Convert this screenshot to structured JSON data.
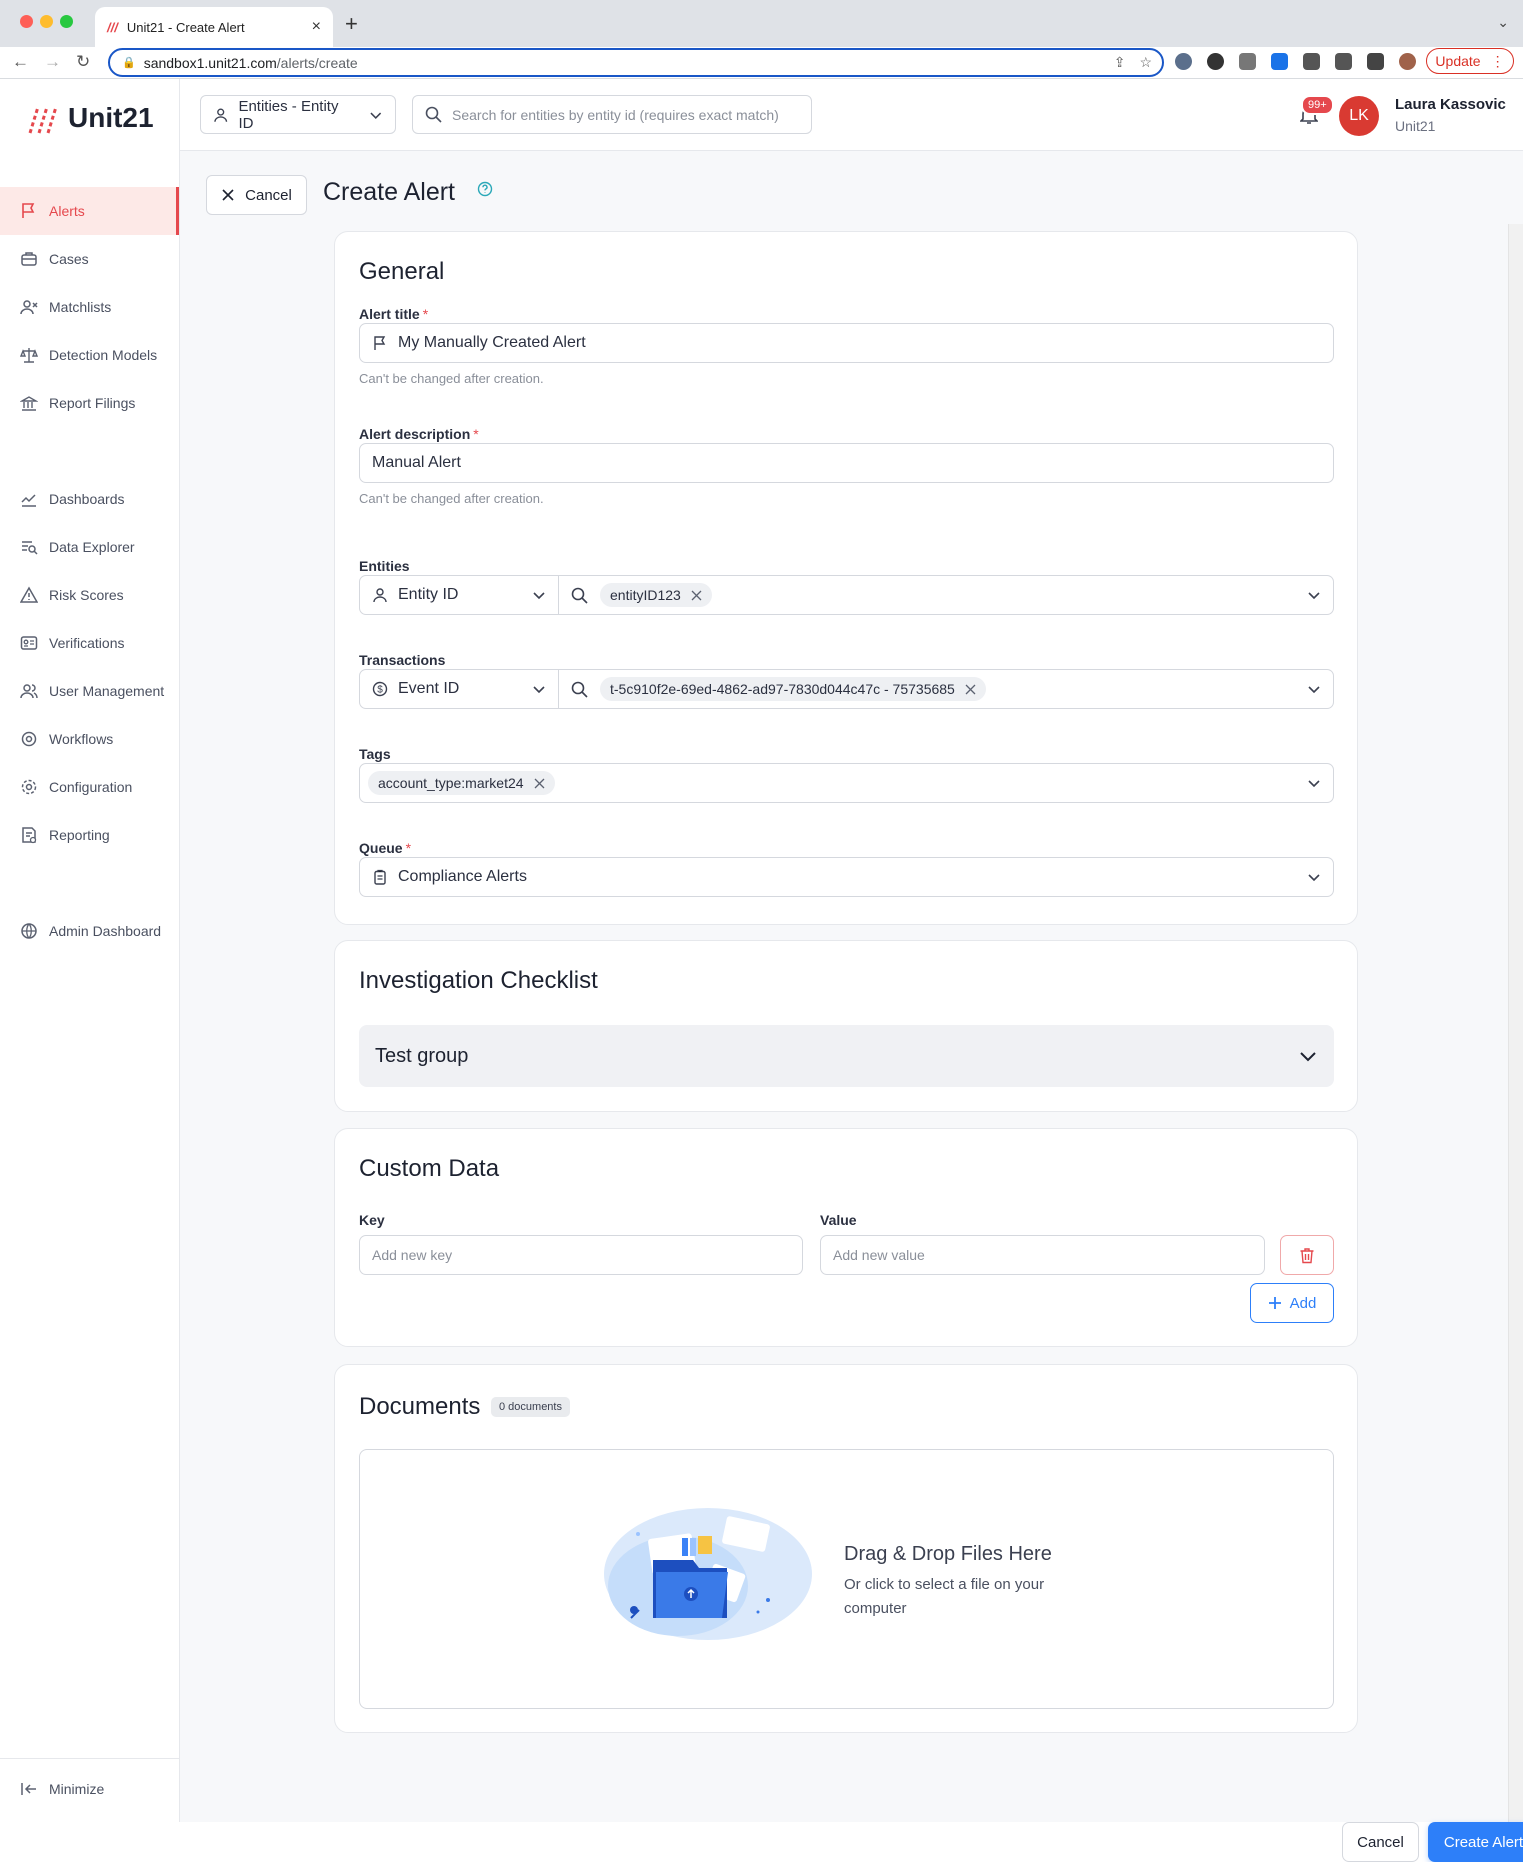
{
  "browser": {
    "tab_title": "Unit21 - Create Alert",
    "url_host": "sandbox1.unit21.com",
    "url_path": "/alerts/create",
    "update_label": "Update"
  },
  "app": {
    "logo_text": "Unit21",
    "brand_color": "#e5484d",
    "accent_color": "#2d7ff9"
  },
  "sidebar": {
    "items": [
      {
        "label": "Alerts",
        "icon": "flag-icon",
        "active": true
      },
      {
        "label": "Cases",
        "icon": "briefcase-icon"
      },
      {
        "label": "Matchlists",
        "icon": "user-x-icon"
      },
      {
        "label": "Detection Models",
        "icon": "scale-icon"
      },
      {
        "label": "Report Filings",
        "icon": "bank-icon"
      },
      {
        "label": "Dashboards",
        "icon": "line-chart-icon"
      },
      {
        "label": "Data Explorer",
        "icon": "data-search-icon"
      },
      {
        "label": "Risk Scores",
        "icon": "warning-icon"
      },
      {
        "label": "Verifications",
        "icon": "id-card-icon"
      },
      {
        "label": "User Management",
        "icon": "users-icon"
      },
      {
        "label": "Workflows",
        "icon": "workflow-icon"
      },
      {
        "label": "Configuration",
        "icon": "gear-icon"
      },
      {
        "label": "Reporting",
        "icon": "report-icon"
      },
      {
        "label": "Admin Dashboard",
        "icon": "globe-icon"
      }
    ],
    "minimize_label": "Minimize"
  },
  "topbar": {
    "entity_select": "Entities - Entity ID",
    "search_placeholder": "Search for entities by entity id (requires exact match)",
    "notifications_count": "99+",
    "user_initials": "LK",
    "user_name": "Laura Kassovic",
    "user_org": "Unit21"
  },
  "page": {
    "cancel_label": "Cancel",
    "title": "Create Alert"
  },
  "general": {
    "heading": "General",
    "alert_title_label": "Alert title",
    "alert_title_value": "My Manually Created Alert",
    "alert_title_hint": "Can't be changed after creation.",
    "alert_desc_label": "Alert description",
    "alert_desc_value": "Manual Alert",
    "alert_desc_hint": "Can't be changed after creation.",
    "entities_label": "Entities",
    "entities_type": "Entity ID",
    "entities_chip": "entityID123",
    "transactions_label": "Transactions",
    "transactions_type": "Event ID",
    "transactions_chip": "t-5c910f2e-69ed-4862-ad97-7830d044c47c - 75735685",
    "tags_label": "Tags",
    "tags_chip": "account_type:market24",
    "queue_label": "Queue",
    "queue_value": "Compliance Alerts"
  },
  "checklist": {
    "heading": "Investigation Checklist",
    "group_label": "Test group"
  },
  "custom_data": {
    "heading": "Custom Data",
    "key_label": "Key",
    "key_placeholder": "Add new key",
    "value_label": "Value",
    "value_placeholder": "Add new value",
    "add_label": "Add"
  },
  "documents": {
    "heading": "Documents",
    "count_badge": "0 documents",
    "drop_title": "Drag & Drop Files Here",
    "drop_subtitle": "Or click to select a file on your computer"
  },
  "footer": {
    "cancel_label": "Cancel",
    "create_label": "Create Alert"
  }
}
